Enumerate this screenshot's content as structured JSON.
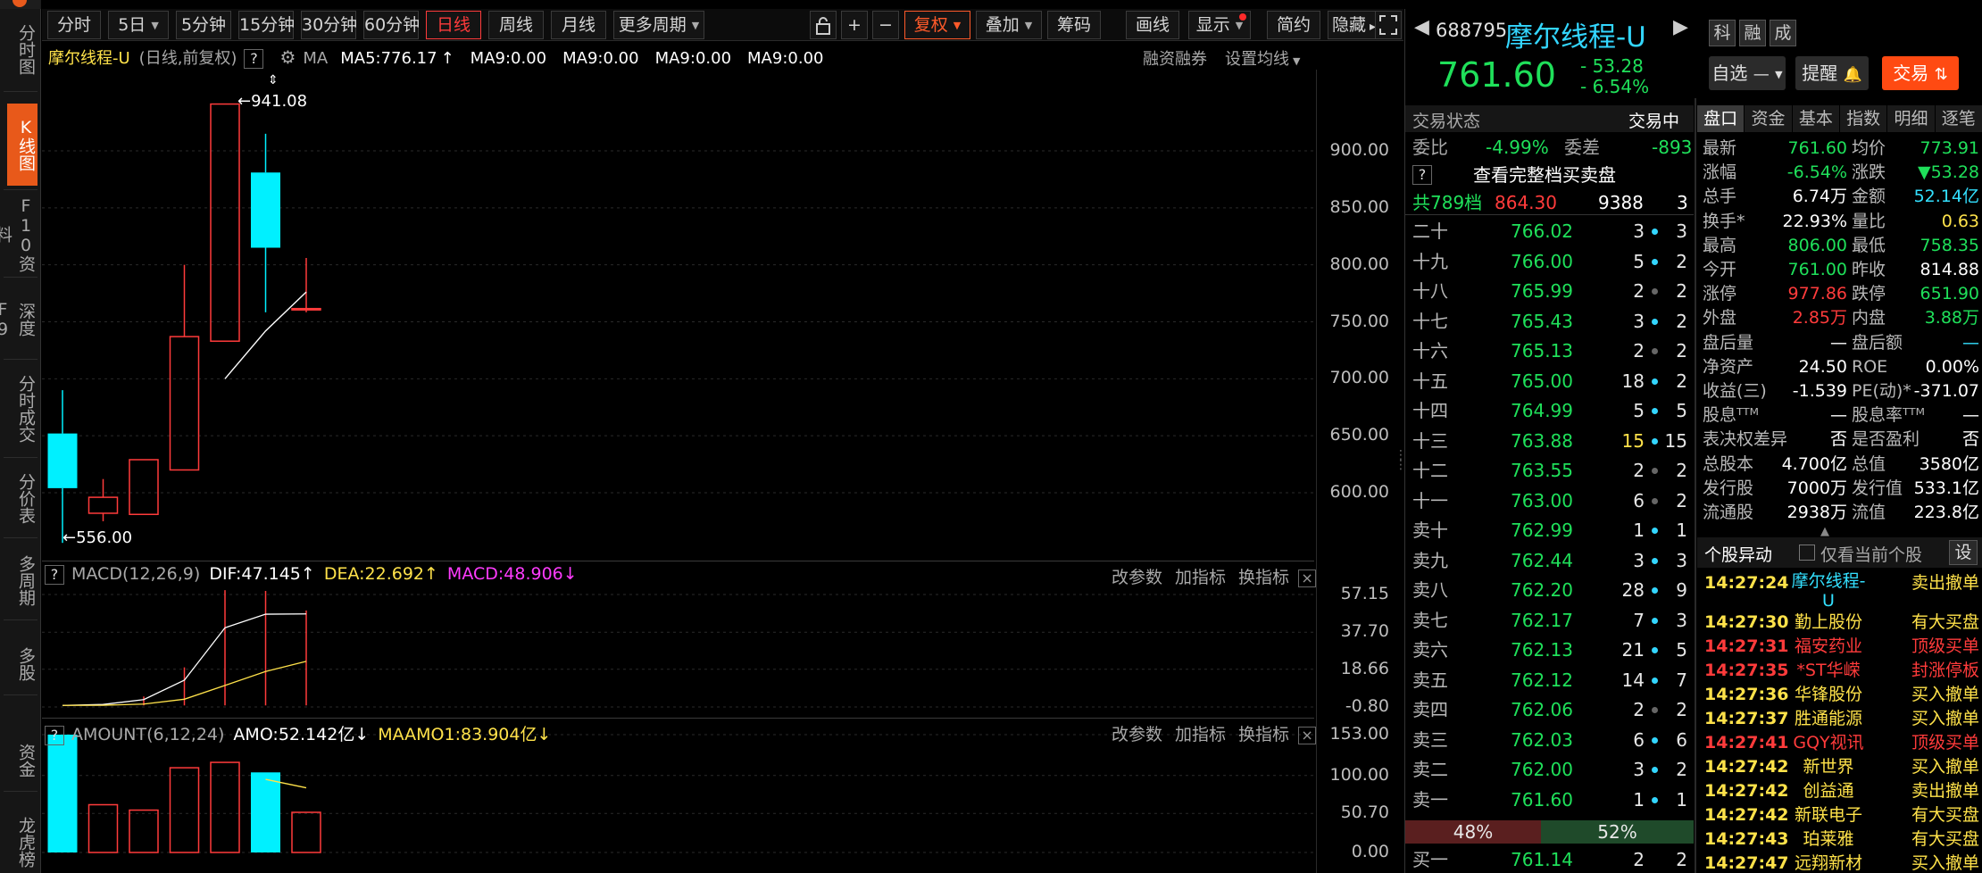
{
  "sidebar": {
    "items": [
      {
        "id": "fenshi",
        "label": "分时图",
        "top": 12,
        "h": 86
      },
      {
        "id": "kline",
        "label": "K线图",
        "top": 116,
        "h": 92,
        "active": true
      },
      {
        "id": "f10",
        "label": "F10资料",
        "top": 218,
        "h": 88
      },
      {
        "id": "shendu",
        "label": "深度F9",
        "top": 318,
        "h": 80
      },
      {
        "id": "fscj",
        "label": "分时成交",
        "top": 408,
        "h": 100
      },
      {
        "id": "fjb",
        "label": "分价表",
        "top": 518,
        "h": 80
      },
      {
        "id": "dzq",
        "label": "多周期",
        "top": 610,
        "h": 80
      },
      {
        "id": "dg",
        "label": "多股",
        "top": 714,
        "h": 60
      },
      {
        "id": "zj",
        "label": "资金",
        "top": 822,
        "h": 60
      },
      {
        "id": "lhb",
        "label": "龙虎榜",
        "top": 908,
        "h": 70
      }
    ]
  },
  "toolbar": {
    "periods": [
      "分时",
      "5日",
      "5分钟",
      "15分钟",
      "30分钟",
      "60分钟",
      "日线",
      "周线",
      "月线",
      "更多周期"
    ],
    "tools": {
      "lock": "lock-icon",
      "plus": "+",
      "minus": "−",
      "fuquan": "复权",
      "diejia": "叠加",
      "chouma": "筹码",
      "huaxian": "画线",
      "xianshi": "显示",
      "jianyue": "简约",
      "yincang": "隐藏"
    }
  },
  "kline": {
    "title": "摩尔线程-U",
    "subtitle": "(日线,前复权)",
    "ma_label": "MA",
    "ma5": "MA5:776.17",
    "ma9a": "MA9:0.00",
    "ma9b": "MA9:0.00",
    "ma9c": "MA9:0.00",
    "ma9d": "MA9:0.00",
    "rongzi": "融资融券",
    "shezhi": "设置均线",
    "high_label": "941.08",
    "low_label": "556.00",
    "yticks": [
      "900.00",
      "850.00",
      "800.00",
      "750.00",
      "700.00",
      "650.00",
      "600.00"
    ]
  },
  "chart_data": [
    {
      "type": "candlestick",
      "title": "摩尔线程-U",
      "xlabel": "",
      "ylabel": "",
      "ylim": [
        556,
        941.08
      ],
      "candles": [
        {
          "open": 652,
          "close": 604,
          "high": 690,
          "low": 556
        },
        {
          "open": 582,
          "close": 596,
          "high": 612,
          "low": 575
        },
        {
          "open": 581,
          "close": 629,
          "high": 629,
          "low": 581
        },
        {
          "open": 620,
          "close": 737,
          "high": 800,
          "low": 620
        },
        {
          "open": 733,
          "close": 941.08,
          "high": 941.08,
          "low": 733
        },
        {
          "open": 881,
          "close": 815,
          "high": 915,
          "low": 758.35
        },
        {
          "open": 761,
          "close": 761.6,
          "high": 806,
          "low": 758.35
        }
      ],
      "ma5": [
        null,
        null,
        null,
        null,
        700,
        742,
        776.17
      ]
    },
    {
      "type": "line",
      "title": "MACD(12,26,9)",
      "ylim": [
        -0.8,
        57.15
      ],
      "series": [
        {
          "name": "DIF",
          "values": [
            0,
            0.5,
            3,
            13,
            40,
            47,
            47.145
          ]
        },
        {
          "name": "DEA",
          "values": [
            0,
            0.1,
            0.7,
            3.2,
            10.3,
            17.5,
            22.692
          ]
        }
      ],
      "bars": [
        0,
        0.8,
        4.6,
        19.6,
        59.4,
        59,
        48.906
      ]
    },
    {
      "type": "bar",
      "title": "AMOUNT(6,12,24)",
      "ylim": [
        0,
        153
      ],
      "values": [
        153,
        62,
        55,
        110,
        117,
        104,
        52.142
      ],
      "ma": [
        null,
        null,
        null,
        null,
        null,
        95,
        83.904
      ]
    }
  ],
  "macd": {
    "title": "MACD(12,26,9)",
    "dif": "DIF:47.145",
    "dea": "DEA:22.692",
    "macd": "MACD:48.906",
    "gaicanshu": "改参数",
    "jiazhibiao": "加指标",
    "huanzhibiao": "换指标",
    "yticks": [
      "57.15",
      "37.70",
      "18.66",
      "-0.80"
    ]
  },
  "amount": {
    "title": "AMOUNT(6,12,24)",
    "amo": "AMO:52.142亿",
    "maamo": "MAAMO1:83.904亿",
    "gaicanshu": "改参数",
    "jiazhibiao": "加指标",
    "huanzhibiao": "换指标",
    "yticks": [
      "153.00",
      "100.00",
      "50.70",
      "0.00"
    ]
  },
  "quote": {
    "code": "688795",
    "name": "摩尔线程-U",
    "price": "761.60",
    "chg": "- 53.28",
    "pct": "- 6.54%",
    "badges": [
      "科",
      "融",
      "成"
    ],
    "zixuan": "自选",
    "tixing": "提醒",
    "jiaoyi": "交易"
  },
  "orderbook": {
    "status_label": "交易状态",
    "status": "交易中",
    "weibi_label": "委比",
    "weibi": "-4.99%",
    "weicha_label": "委差",
    "weicha": "-893",
    "full_link": "查看完整档买卖盘",
    "total_label": "共789档",
    "total_price": "864.30",
    "total_vol": "9388",
    "total_cnt": "3",
    "asks": [
      {
        "lab": "二十",
        "pr": "766.02",
        "vol": "3",
        "cnt": "3",
        "dot": "#33d6ff"
      },
      {
        "lab": "十九",
        "pr": "766.00",
        "vol": "5",
        "cnt": "2",
        "dot": "#33d6ff"
      },
      {
        "lab": "十八",
        "pr": "765.99",
        "vol": "2",
        "cnt": "2",
        "dot": "#666"
      },
      {
        "lab": "十七",
        "pr": "765.43",
        "vol": "3",
        "cnt": "2",
        "dot": "#33d6ff"
      },
      {
        "lab": "十六",
        "pr": "765.13",
        "vol": "2",
        "cnt": "2",
        "dot": "#666"
      },
      {
        "lab": "十五",
        "pr": "765.00",
        "vol": "18",
        "cnt": "2",
        "dot": "#33d6ff"
      },
      {
        "lab": "十四",
        "pr": "764.99",
        "vol": "5",
        "cnt": "5",
        "dot": "#33d6ff"
      },
      {
        "lab": "十三",
        "pr": "763.88",
        "vol": "15",
        "cnt": "15",
        "dot": "#33d6ff",
        "hl": true
      },
      {
        "lab": "十二",
        "pr": "763.55",
        "vol": "2",
        "cnt": "2",
        "dot": "#666"
      },
      {
        "lab": "十一",
        "pr": "763.00",
        "vol": "6",
        "cnt": "2",
        "dot": "#666"
      },
      {
        "lab": "卖十",
        "pr": "762.99",
        "vol": "1",
        "cnt": "1",
        "dot": "#33d6ff"
      },
      {
        "lab": "卖九",
        "pr": "762.44",
        "vol": "3",
        "cnt": "3",
        "dot": "#33d6ff"
      },
      {
        "lab": "卖八",
        "pr": "762.20",
        "vol": "28",
        "cnt": "9",
        "dot": "#33d6ff"
      },
      {
        "lab": "卖七",
        "pr": "762.17",
        "vol": "7",
        "cnt": "3",
        "dot": "#33d6ff"
      },
      {
        "lab": "卖六",
        "pr": "762.13",
        "vol": "21",
        "cnt": "5",
        "dot": "#33d6ff"
      },
      {
        "lab": "卖五",
        "pr": "762.12",
        "vol": "14",
        "cnt": "7",
        "dot": "#33d6ff"
      },
      {
        "lab": "卖四",
        "pr": "762.06",
        "vol": "2",
        "cnt": "2",
        "dot": "#666"
      },
      {
        "lab": "卖三",
        "pr": "762.03",
        "vol": "6",
        "cnt": "6",
        "dot": "#33d6ff"
      },
      {
        "lab": "卖二",
        "pr": "762.00",
        "vol": "3",
        "cnt": "2",
        "dot": "#33d6ff"
      },
      {
        "lab": "卖一",
        "pr": "761.60",
        "vol": "1",
        "cnt": "1",
        "dot": "#33d6ff"
      }
    ],
    "ratio_left": "48%",
    "ratio_right": "52%",
    "bid1": {
      "lab": "买一",
      "pr": "761.14",
      "vol": "2",
      "cnt": "2"
    }
  },
  "tabs": [
    "盘口",
    "资金",
    "基本",
    "指数",
    "明细",
    "逐笔"
  ],
  "stats": [
    {
      "l1": "最新",
      "v1": "761.60",
      "c1": "grn",
      "l2": "均价",
      "v2": "773.91",
      "c2": "grn"
    },
    {
      "l1": "涨幅",
      "v1": "-6.54%",
      "c1": "grn",
      "l2": "涨跌",
      "v2": "▼53.28",
      "c2": "grn"
    },
    {
      "l1": "总手",
      "v1": "6.74万",
      "c1": "wht",
      "l2": "金额",
      "v2": "52.14亿",
      "c2": "cyan"
    },
    {
      "l1": "换手*",
      "v1": "22.93%",
      "c1": "wht",
      "l2": "量比",
      "v2": "0.63",
      "c2": "yel"
    },
    {
      "l1": "最高",
      "v1": "806.00",
      "c1": "grn",
      "l2": "最低",
      "v2": "758.35",
      "c2": "grn"
    },
    {
      "l1": "今开",
      "v1": "761.00",
      "c1": "grn",
      "l2": "昨收",
      "v2": "814.88",
      "c2": "wht"
    },
    {
      "l1": "涨停",
      "v1": "977.86",
      "c1": "red",
      "l2": "跌停",
      "v2": "651.90",
      "c2": "grn"
    },
    {
      "l1": "外盘",
      "v1": "2.85万",
      "c1": "red",
      "l2": "内盘",
      "v2": "3.88万",
      "c2": "grn"
    },
    {
      "l1": "盘后量",
      "v1": "—",
      "c1": "wht",
      "l2": "盘后额",
      "v2": "—",
      "c2": "cyan"
    },
    {
      "l1": "净资产",
      "v1": "24.50",
      "c1": "wht",
      "l2": "ROE",
      "v2": "0.00%",
      "c2": "wht"
    },
    {
      "l1": "收益(三)",
      "v1": "-1.539",
      "c1": "wht",
      "l2": "PE(动)*",
      "v2": "-371.07",
      "c2": "wht"
    },
    {
      "l1": "股息ᵀᵀᴹ",
      "v1": "—",
      "c1": "wht",
      "l2": "股息率ᵀᵀᴹ",
      "v2": "—",
      "c2": "wht"
    },
    {
      "l1": "表决权差异",
      "v1": "否",
      "c1": "wht",
      "l2": "是否盈利",
      "v2": "否",
      "c2": "wht"
    },
    {
      "l1": "总股本",
      "v1": "4.700亿",
      "c1": "wht",
      "l2": "总值",
      "v2": "3580亿",
      "c2": "wht"
    },
    {
      "l1": "发行股",
      "v1": "7000万",
      "c1": "wht",
      "l2": "发行值",
      "v2": "533.1亿",
      "c2": "wht"
    },
    {
      "l1": "流通股",
      "v1": "2938万",
      "c1": "wht",
      "l2": "流值",
      "v2": "223.8亿",
      "c2": "wht"
    }
  ],
  "events": {
    "title": "个股异动",
    "only_label": "仅看当前个股",
    "settings": "设",
    "items": [
      {
        "t": "14:27:24",
        "n": "摩尔线程-U",
        "e": "卖出撤单",
        "nc": "cyan",
        "tc": "yel",
        "ec": "yel",
        "two": true
      },
      {
        "t": "14:27:30",
        "n": "勤上股份",
        "e": "有大买盘",
        "nc": "yel",
        "tc": "yel",
        "ec": "yel"
      },
      {
        "t": "14:27:31",
        "n": "福安药业",
        "e": "顶级买单",
        "nc": "red",
        "tc": "red",
        "ec": "red"
      },
      {
        "t": "14:27:35",
        "n": "*ST华嵘",
        "e": "封涨停板",
        "nc": "red",
        "tc": "red",
        "ec": "red"
      },
      {
        "t": "14:27:36",
        "n": "华锋股份",
        "e": "买入撤单",
        "nc": "yel",
        "tc": "yel",
        "ec": "yel"
      },
      {
        "t": "14:27:37",
        "n": "胜通能源",
        "e": "买入撤单",
        "nc": "yel",
        "tc": "yel",
        "ec": "yel"
      },
      {
        "t": "14:27:41",
        "n": "GQY视讯",
        "e": "顶级买单",
        "nc": "red",
        "tc": "red",
        "ec": "red"
      },
      {
        "t": "14:27:42",
        "n": "新世界",
        "e": "买入撤单",
        "nc": "yel",
        "tc": "yel",
        "ec": "yel"
      },
      {
        "t": "14:27:42",
        "n": "创益通",
        "e": "卖出撤单",
        "nc": "yel",
        "tc": "yel",
        "ec": "yel"
      },
      {
        "t": "14:27:42",
        "n": "新联电子",
        "e": "有大买盘",
        "nc": "yel",
        "tc": "yel",
        "ec": "yel"
      },
      {
        "t": "14:27:43",
        "n": "珀莱雅",
        "e": "有大买盘",
        "nc": "yel",
        "tc": "yel",
        "ec": "yel"
      },
      {
        "t": "14:27:47",
        "n": "远翔新材",
        "e": "买入撤单",
        "nc": "yel",
        "tc": "yel",
        "ec": "yel"
      }
    ]
  },
  "colors": {
    "up": "#ff3b3b",
    "down": "#1fe05a",
    "candle_down": "#00f0ff",
    "ma5": "#ffffff",
    "dea": "#ffe24a",
    "macd": "#ff3bff",
    "accent": "#e8591a"
  }
}
